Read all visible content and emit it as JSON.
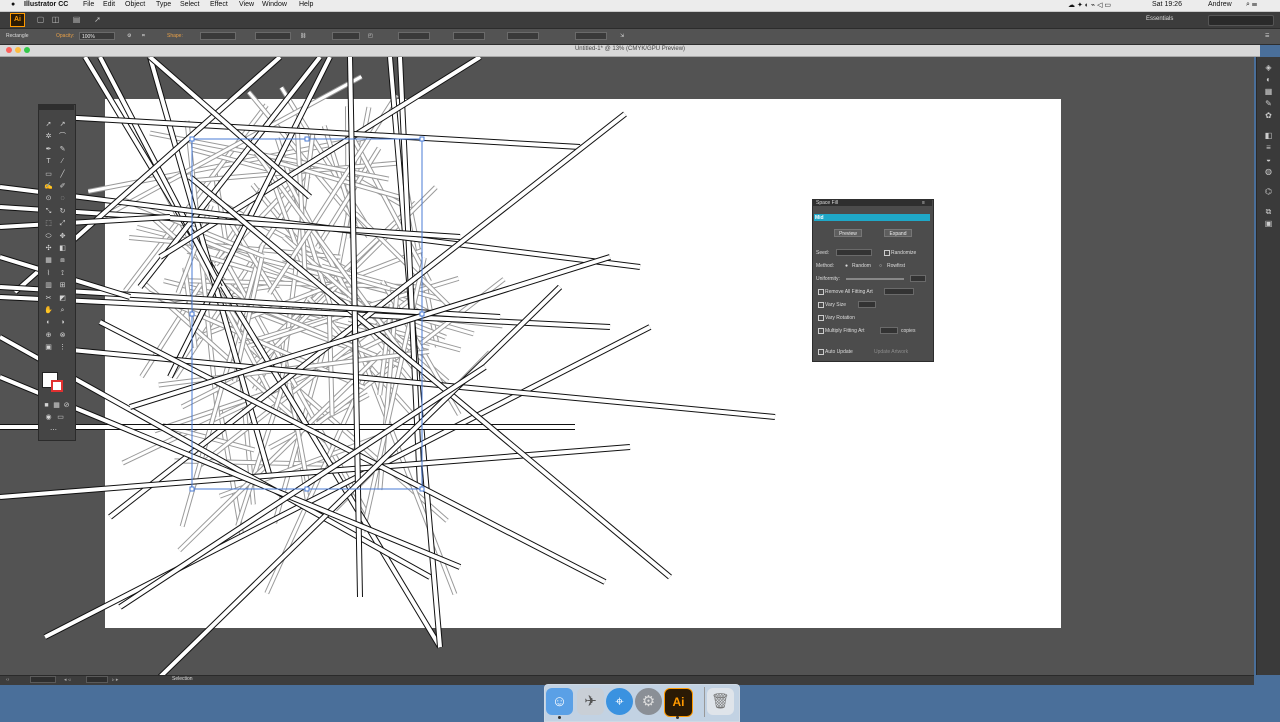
{
  "menubar": {
    "apple": "",
    "app_name": "Illustrator CC",
    "items": [
      "File",
      "Edit",
      "Object",
      "Type",
      "Select",
      "Effect",
      "View",
      "Window",
      "Help"
    ],
    "clock": "Sat 19:26",
    "user": "Andrew"
  },
  "appbar": {
    "logo": "Ai",
    "workspace": "Essentials",
    "search_placeholder": ""
  },
  "control_bar": {
    "selection_type": "Rectangle",
    "opacity_label": "Opacity:",
    "opacity_value": "100%",
    "shape_label": "Shape:",
    "fields": [
      "",
      "",
      "",
      "",
      "",
      "",
      "",
      ""
    ]
  },
  "document": {
    "title": "Untitled-1* @ 13% (CMYK/GPU Preview)"
  },
  "space_fill_panel": {
    "title": "Space Fill",
    "tab": "Mid",
    "btn_preview": "Preview",
    "btn_expand": "Expand",
    "seed_label": "Seed:",
    "seed_value": "",
    "randomize_label": "Randomize",
    "method_label": "Method:",
    "method_a": "Random",
    "method_b": "Rowfirst",
    "uniformity_label": "Uniformity:",
    "remove_label": "Remove All Fitting Art",
    "vary_size_label": "Vary Size",
    "vary_rotation_label": "Vary Rotation",
    "multiply_label": "Multiply Fitting Art",
    "copies_label": "copies",
    "auto_update_label": "Auto Update",
    "update_btn": "Update Artwork",
    "fields": [
      "",
      "",
      "",
      ""
    ]
  },
  "status_bar": {
    "zoom": "",
    "artboard": "",
    "tool": "Selection"
  },
  "dock": {
    "apps": [
      "finder-icon",
      "launchpad-icon",
      "safari-icon",
      "system-preferences-icon",
      "illustrator-icon",
      "trash-icon"
    ],
    "ai_label": "Ai"
  },
  "colors": {
    "canvas_bg": "#535353",
    "artboard": "#ffffff",
    "selection_blue": "#4a7bd6",
    "panel_accent": "#1fa8c8",
    "stroke_swatch": "#e03030",
    "desktop": "#4a6f9a"
  }
}
